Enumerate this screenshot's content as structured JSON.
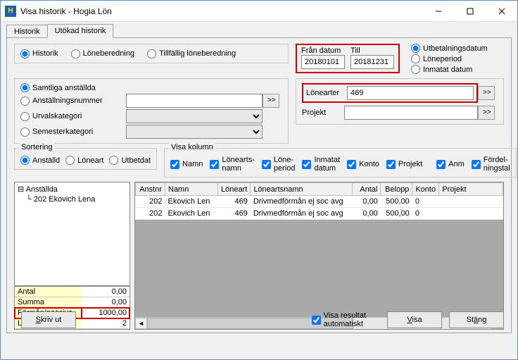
{
  "window": {
    "title": "Visa historik - Hogia Lön"
  },
  "tabs": {
    "historik": "Historik",
    "utokad": "Utökad historik"
  },
  "typeRadios": {
    "historik": "Historik",
    "loneberedning": "Löneberedning",
    "tillfallig": "Tillfällig löneberedning"
  },
  "dates": {
    "fromLabel": "Från datum",
    "toLabel": "Till",
    "from": "20180101",
    "to": "20181231"
  },
  "dateMode": {
    "utbet": "Utbetalningsdatum",
    "period": "Löneperiod",
    "inmatat": "Inmatat datum"
  },
  "selection": {
    "samtliga": "Samtliga anställda",
    "anstnr": "Anställningsnummer",
    "urval": "Urvalskategori",
    "semester": "Semesterkategori",
    "goBtn": ">>"
  },
  "filters": {
    "lonearterLabel": "Lönearter",
    "lonearterValue": "469",
    "projektLabel": "Projekt",
    "projektValue": "",
    "goBtn": ">>"
  },
  "sort": {
    "title": "Sortering",
    "anstalld": "Anställd",
    "loneart": "Löneart",
    "utbetdat": "Utbetdat"
  },
  "kolumn": {
    "title": "Visa kolumn",
    "namn": "Namn",
    "lonenamn": "Lönearts-\nnamn",
    "loneperiod": "Löne-\nperiod",
    "inmatat": "Inmatat\ndatum",
    "konto": "Konto",
    "projekt": "Projekt",
    "anm": "Anm",
    "fordel": "Fördel-\nningstal"
  },
  "tree": {
    "root": "Anställda",
    "child1": "202 Ekovich Lena"
  },
  "summary": {
    "antalLabel": "Antal",
    "antal": "0,00",
    "summaLabel": "Summa",
    "summa": "0,00",
    "formanLabel": "Förmån/passiva",
    "forman": "1000,00",
    "loneraderLabel": "Lönerader",
    "lonerader": "2"
  },
  "grid": {
    "headers": {
      "anstnr": "Anstnr",
      "namn": "Namn",
      "loneart": "Löneart",
      "loneartsnamn": "Löneartsnamn",
      "antal": "Antal",
      "belopp": "Belopp",
      "konto": "Konto",
      "projekt": "Projekt"
    },
    "rows": [
      {
        "anstnr": "202",
        "namn": "Ekovich Len",
        "loneart": "469",
        "loneartsnamn": "Drivmedförmån ej soc avg",
        "antal": "0,00",
        "belopp": "500,00",
        "konto": "0",
        "projekt": ""
      },
      {
        "anstnr": "202",
        "namn": "Ekovich Len",
        "loneart": "469",
        "loneartsnamn": "Drivmedförmån ej soc avg",
        "antal": "0,00",
        "belopp": "500,00",
        "konto": "0",
        "projekt": ""
      }
    ]
  },
  "footer": {
    "skrivut": "Skriv ut",
    "visaAuto": "Visa resultat\nautomatiskt",
    "visa": "Visa",
    "stang": "Stäng"
  }
}
